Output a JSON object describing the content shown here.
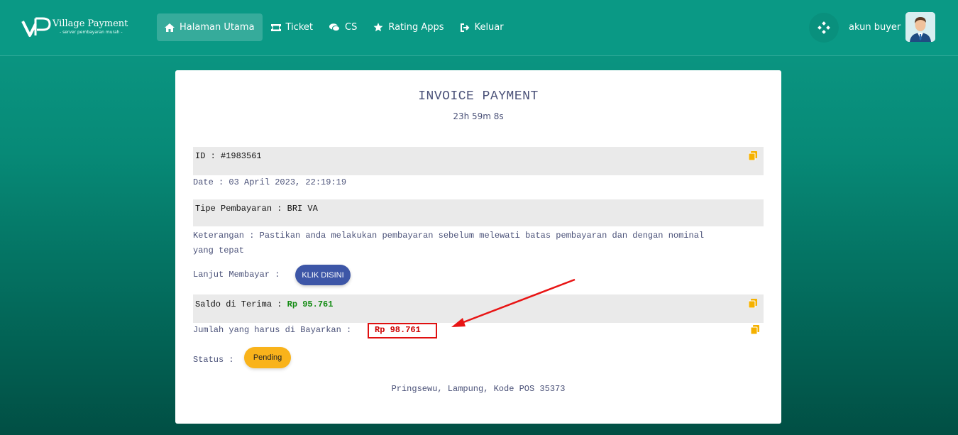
{
  "brand": {
    "title": "Village Payment",
    "tagline": "- server pembayaran murah -"
  },
  "nav": {
    "items": [
      {
        "label": "Halaman Utama",
        "icon": "home-icon"
      },
      {
        "label": "Ticket",
        "icon": "ticket-icon"
      },
      {
        "label": "CS",
        "icon": "chat-icon"
      },
      {
        "label": "Rating Apps",
        "icon": "star-icon"
      },
      {
        "label": "Keluar",
        "icon": "logout-icon"
      }
    ]
  },
  "user": {
    "name": "akun buyer"
  },
  "invoice": {
    "title": "INVOICE PAYMENT",
    "countdown": "23h 59m 8s",
    "id_label": "ID : #1983561",
    "date_label": "Date : 03 April 2023, 22:19:19",
    "type_label": "Tipe Pembayaran : BRI VA",
    "note_line1": "Keterangan : Pastikan anda melakukan pembayaran sebelum melewati batas pembayaran dan dengan nominal",
    "note_line2": "yang tepat",
    "continue_label": "Lanjut Membayar :",
    "continue_button": "KLIK DISINI",
    "received_label": "Saldo di Terima :",
    "received_value": "Rp 95.761",
    "amount_label": "Jumlah yang harus di Bayarkan :",
    "amount_value": "Rp 98.761",
    "status_label": "Status :",
    "status_value": "Pending",
    "footer": "Pringsewu, Lampung, Kode POS 35373"
  },
  "colors": {
    "teal": "#0a9985",
    "copy_icon": "#f5b100",
    "received_green": "#108a10",
    "amount_red": "#cc0000",
    "button_blue": "#3d56a7",
    "status_orange": "#f9b31b"
  }
}
